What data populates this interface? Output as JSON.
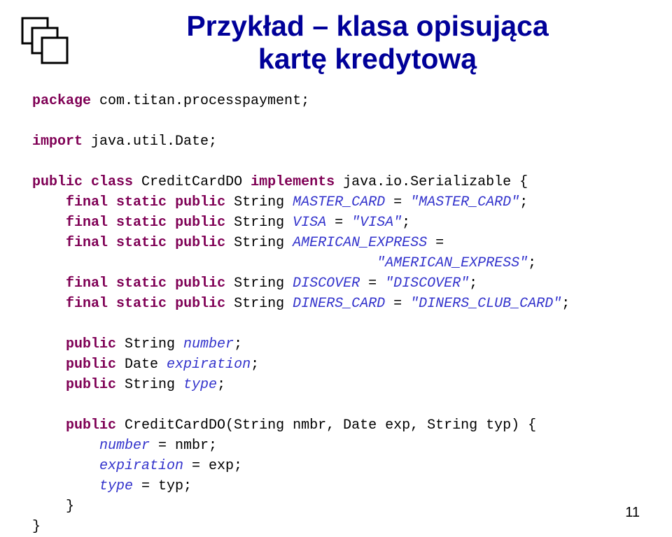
{
  "title_line1": "Przykład – klasa opisująca",
  "title_line2": "kartę kredytową",
  "code": {
    "kw_package": "package",
    "pkg_stmt": " com.titan.processpayment;",
    "kw_import": "import",
    "import_stmt": " java.util.Date;",
    "kw_public": "public",
    "kw_class": "class",
    "cls_name": " CreditCardDO ",
    "kw_implements": "implements",
    "impl_target": " java.io.Serializable {",
    "kw_final": "final",
    "kw_static": "static",
    "mc_decl": " String ",
    "mc_const": "MASTER_CARD",
    "eq_open": " = ",
    "mc_val": "\"MASTER_CARD\"",
    "sc": ";",
    "visa_const": "VISA",
    "visa_val": "\"VISA\"",
    "ae_const": "AMERICAN_EXPRESS",
    "ae_eq": " =",
    "ae_val": "\"AMERICAN_EXPRESS\"",
    "disc_const": "DISCOVER",
    "disc_val": "\"DISCOVER\"",
    "din_const": "DINERS_CARD",
    "din_val": "\"DINERS_CLUB_CARD\"",
    "num_decl": " String ",
    "num_name": "number",
    "date_decl": " Date ",
    "exp_name": "expiration",
    "type_name": "type",
    "ctor_name": " CreditCardDO(String nmbr, Date exp, String typ) {",
    "assign1a": "number",
    "assign1b": " = nmbr;",
    "assign2a": "expiration",
    "assign2b": " = exp;",
    "assign3a": "type",
    "assign3b": " = typ;",
    "brace_close": "}",
    "indent1": "    ",
    "indent2": "        ",
    "long_indent": "                                         "
  },
  "page_number": "11"
}
